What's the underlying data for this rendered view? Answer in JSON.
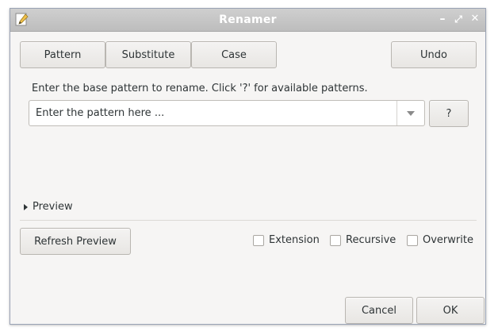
{
  "window": {
    "title": "Renamer",
    "controls": {
      "minimize": "–",
      "maximize": "⤢",
      "close": "✕"
    }
  },
  "tabs": {
    "pattern": "Pattern",
    "substitute": "Substitute",
    "case": "Case",
    "undo": "Undo"
  },
  "pattern_section": {
    "instruction": "Enter the base pattern to rename. Click '?' for available patterns.",
    "input_value": "Enter the pattern here ...",
    "help_label": "?"
  },
  "preview": {
    "expander_label": "Preview",
    "refresh_label": "Refresh Preview"
  },
  "options": [
    {
      "label": "Extension",
      "checked": false
    },
    {
      "label": "Recursive",
      "checked": false
    },
    {
      "label": "Overwrite",
      "checked": false
    }
  ],
  "footer": {
    "cancel_label": "Cancel",
    "ok_label": "OK"
  }
}
